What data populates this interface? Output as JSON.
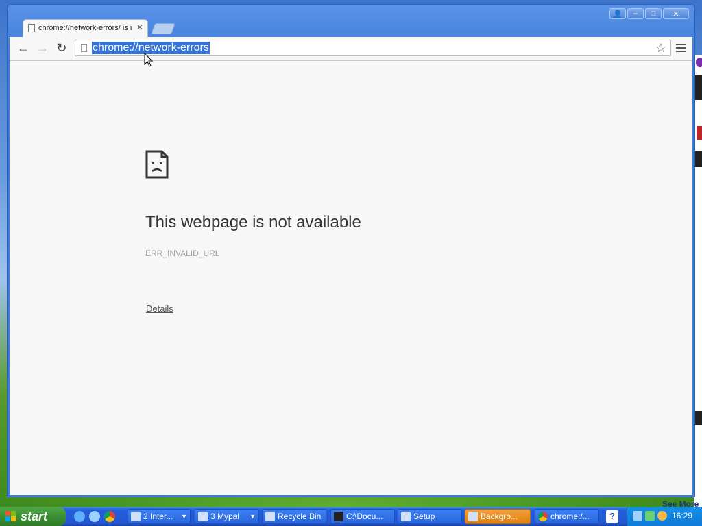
{
  "window": {
    "tab_title": "chrome://network-errors/ is i",
    "controls": {
      "user": "👤",
      "minimize": "–",
      "maximize": "□",
      "close": "✕"
    }
  },
  "toolbar": {
    "back": "←",
    "forward": "→",
    "reload": "↻",
    "url": "chrome://network-errors",
    "bookmark_star": "☆"
  },
  "error_page": {
    "title": "This webpage is not available",
    "code": "ERR_INVALID_URL",
    "details_link": "Details"
  },
  "taskbar": {
    "start_label": "start",
    "buttons": [
      {
        "label": "2 Inter...",
        "has_arrow": true
      },
      {
        "label": "3 Mypal",
        "has_arrow": true
      },
      {
        "label": "Recycle Bin"
      },
      {
        "label": "C:\\Docu..."
      },
      {
        "label": "Setup"
      },
      {
        "label": "Backgro...",
        "active": true
      },
      {
        "label": "chrome:/..."
      }
    ],
    "help": "?",
    "clock": "16:29"
  },
  "background_page": {
    "see_more": "See More"
  }
}
